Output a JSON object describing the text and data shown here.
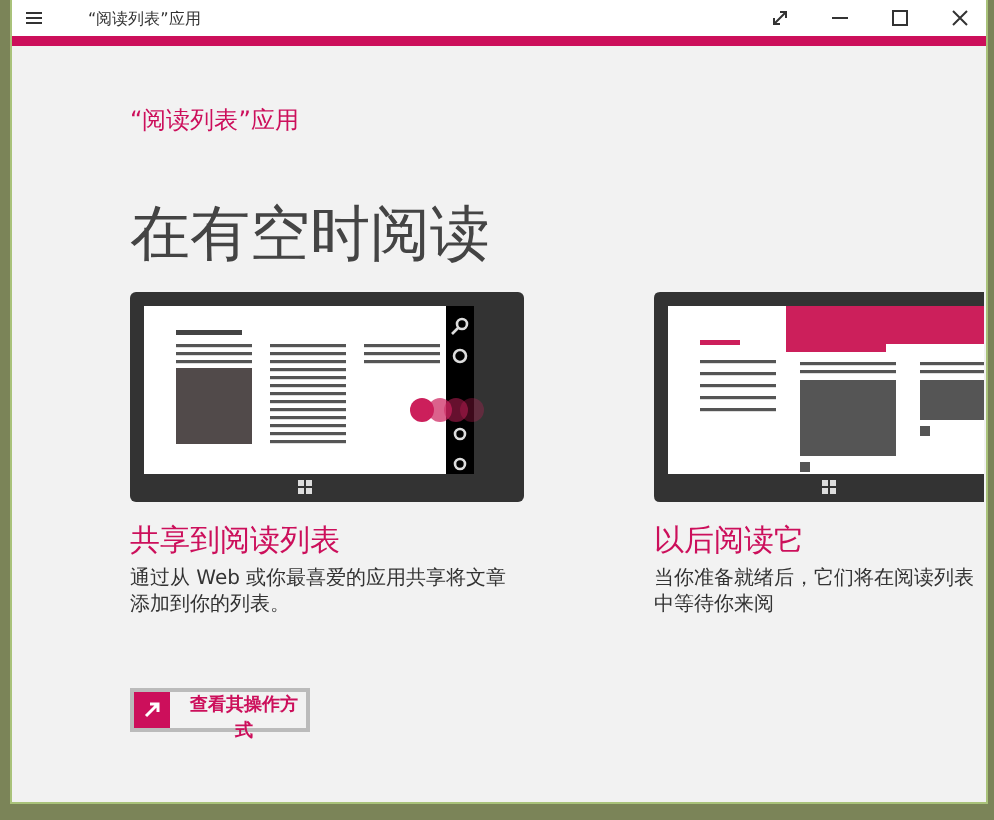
{
  "window": {
    "title": "“阅读列表”应用"
  },
  "app_label": "“阅读列表”应用",
  "heading": "在有空时阅读",
  "features": [
    {
      "kind": "share",
      "title": "共享到阅读列表",
      "description": "通过从 Web 或你最喜爱的应用共享将文章添加到你的列表。"
    },
    {
      "kind": "later",
      "title": "以后阅读它",
      "description": "当你准备就绪后，它们将在阅读列表中等待你来阅"
    }
  ],
  "link_button": {
    "label": "查看其操作方式"
  }
}
